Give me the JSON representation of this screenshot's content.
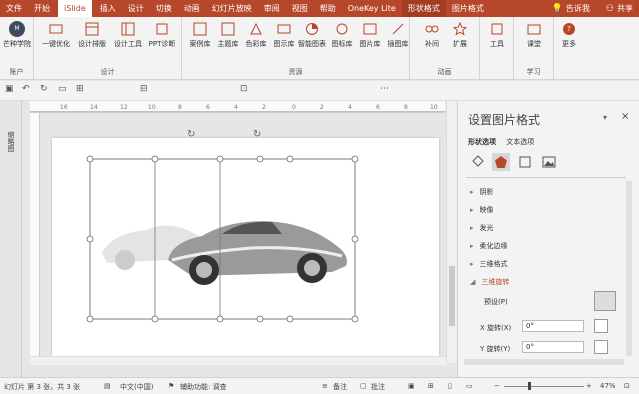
{
  "tabs": [
    "文件",
    "开始",
    "iSlide",
    "插入",
    "设计",
    "切换",
    "动画",
    "幻灯片放映",
    "审阅",
    "视图",
    "帮助",
    "OneKey Lite",
    "形状格式",
    "图片格式"
  ],
  "tell_me": "告诉我",
  "share": "共享",
  "ribbon": {
    "account_btn": "芒种学院",
    "account_group": "账户",
    "design_btns": [
      "一键优化",
      "设计排版",
      "设计工具",
      "PPT诊断"
    ],
    "design_group": "设计",
    "resource_btns": [
      "案例库",
      "主题库",
      "色彩库",
      "图示库",
      "智能图表",
      "图标库",
      "图片库",
      "插图库"
    ],
    "resource_group": "资源",
    "anim_btns": [
      "补间",
      "扩展"
    ],
    "anim_group": "动画",
    "tools_btn": "工具",
    "learn_btn": "课堂",
    "learn_group": "学习",
    "more_btn": "更多"
  },
  "left_strip": "缩略图",
  "pane": {
    "title": "设置图片格式",
    "subtabs": [
      "形状选项",
      "文本选项"
    ],
    "sections": [
      "阴影",
      "映像",
      "发光",
      "柔化边缘",
      "三维格式",
      "三维旋转"
    ],
    "preset_label": "预设(P)",
    "x_label": "X 旋转(X)",
    "x_value": "0°",
    "y_label": "Y 旋转(Y)",
    "y_value": "0°"
  },
  "status": {
    "slide": "幻灯片 第 3 张，共 3 张",
    "lang": "中文(中国)",
    "access": "辅助功能: 调查",
    "notes": "备注",
    "comments": "批注",
    "zoom": "47%"
  }
}
